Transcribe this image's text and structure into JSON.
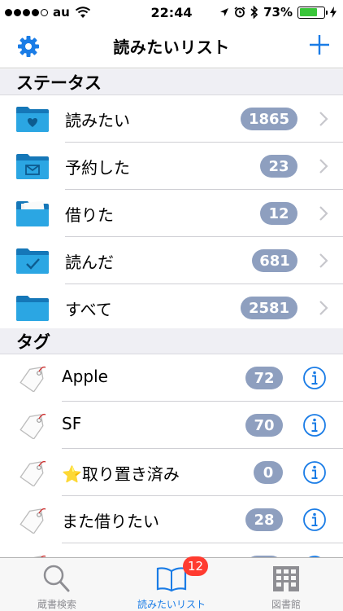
{
  "status_bar": {
    "carrier": "au",
    "time": "22:44",
    "battery": "73%"
  },
  "nav": {
    "title": "読みたいリスト"
  },
  "status_section": {
    "header": "ステータス",
    "items": [
      {
        "label": "読みたい",
        "count": "1865"
      },
      {
        "label": "予約した",
        "count": "23"
      },
      {
        "label": "借りた",
        "count": "12"
      },
      {
        "label": "読んだ",
        "count": "681"
      },
      {
        "label": "すべて",
        "count": "2581"
      }
    ]
  },
  "tag_section": {
    "header": "タグ",
    "items": [
      {
        "label": "Apple",
        "count": "72"
      },
      {
        "label": "SF",
        "count": "70"
      },
      {
        "star": "⭐",
        "label": "取り置き済み",
        "count": "0"
      },
      {
        "label": "また借りたい",
        "count": "28"
      }
    ]
  },
  "tab_bar": {
    "tabs": [
      {
        "label": "蔵書検索"
      },
      {
        "label": "読みたいリスト",
        "badge": "12"
      },
      {
        "label": "図書館"
      }
    ]
  },
  "colors": {
    "accent": "#1a7ce6",
    "badge": "#8e9fbf",
    "folder": "#1c9ad6",
    "tab_badge": "#ff3b30"
  }
}
